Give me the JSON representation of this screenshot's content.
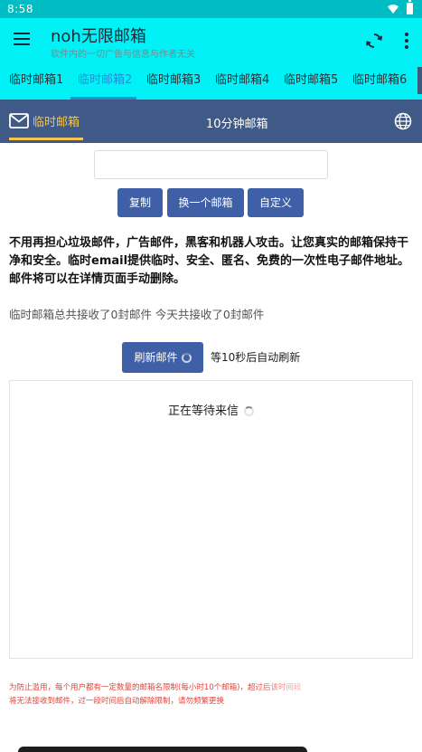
{
  "status_bar": {
    "time": "8:58"
  },
  "app_bar": {
    "title": "noh无限邮箱",
    "subtitle": "软件内的一切广告与信息与作者无关"
  },
  "tabs": [
    {
      "label": "临时邮箱1"
    },
    {
      "label": "临时邮箱2",
      "active": true
    },
    {
      "label": "临时邮箱3"
    },
    {
      "label": "临时邮箱4"
    },
    {
      "label": "临时邮箱5"
    },
    {
      "label": "临时邮箱6"
    }
  ],
  "subnav": {
    "temp_mail_label": "临时邮箱",
    "ten_minute_label": "10分钟邮箱"
  },
  "email_input": {
    "value": "",
    "placeholder": ""
  },
  "buttons": {
    "copy": "复制",
    "change": "换一个邮箱",
    "custom": "自定义",
    "refresh": "刷新邮件"
  },
  "intro_text": "不用再担心垃圾邮件，广告邮件，黑客和机器人攻击。让您真实的邮箱保持干净和安全。临时email提供临时、安全、匿名、免费的一次性电子邮件地址。邮件将可以在详情页面手动删除。",
  "stats_text": "临时邮箱总共接收了0封邮件 今天共接收了0封邮件",
  "refresh_hint": "等10秒后自动刷新",
  "waiting_text": "正在等待来信",
  "footer_note": "为防止滥用，每个用户都有一定数量的邮箱名限制(每小时10个邮箱)，超过后该时间段将无法接收到邮件，过一段时间后自动解除限制，请勿频繁更换",
  "colors": {
    "status_bar": "#00bcc3",
    "app_bar": "#00f1f6",
    "active_tab": "#1f8fd8",
    "subnav": "#3f5a86",
    "subnav_active": "#f5c451",
    "button": "#3f5fa6",
    "footer_note": "#e0433a"
  },
  "icons": {
    "menu": "hamburger-menu-icon",
    "refresh": "refresh-icon",
    "more": "more-vertical-icon",
    "mail": "mail-icon",
    "globe": "globe-icon"
  }
}
